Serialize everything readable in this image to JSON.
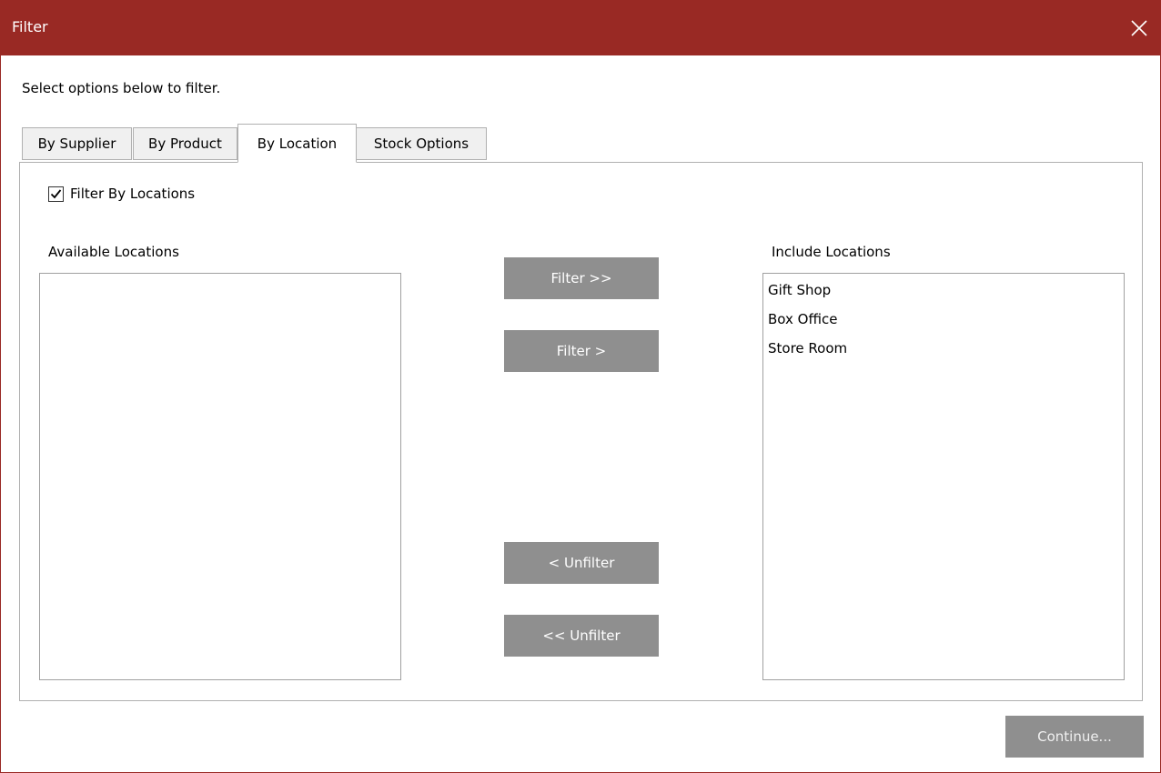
{
  "window": {
    "title": "Filter"
  },
  "instruction": "Select options below to filter.",
  "tabs": [
    {
      "label": "By Supplier"
    },
    {
      "label": "By Product"
    },
    {
      "label": "By Location"
    },
    {
      "label": "Stock Options"
    }
  ],
  "active_tab": "By Location",
  "filter_checkbox": {
    "label": "Filter By Locations",
    "checked": true
  },
  "available": {
    "label": "Available Locations",
    "items": []
  },
  "included": {
    "label": "Include Locations",
    "items": [
      "Gift Shop",
      "Box Office",
      "Store Room"
    ]
  },
  "buttons": {
    "filter_all": "Filter >>",
    "filter_one": "Filter >",
    "unfilter_one": "< Unfilter",
    "unfilter_all": "<< Unfilter",
    "continue": "Continue..."
  },
  "colors": {
    "titlebar": "#992924",
    "button": "#8f8f8f"
  },
  "icons": {
    "close": "close-icon",
    "checkbox": "checkmark-icon"
  }
}
